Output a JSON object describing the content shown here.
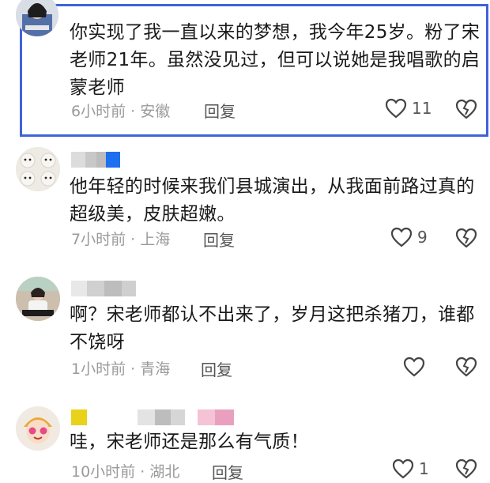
{
  "comments": [
    {
      "text": "你实现了我一直以来的梦想，我今年25岁。粉了宋老师21年。虽然没见过，但可以说她是我唱歌的启蒙老师",
      "time": "6小时前",
      "location": "安徽",
      "reply_label": "回复",
      "likes": "11",
      "highlighted": true,
      "avatar_icon": "user-avatar-photo"
    },
    {
      "text": "他年轻的时候来我们县城演出，从我面前路过真的超级美，皮肤超嫩。",
      "time": "7小时前",
      "location": "上海",
      "reply_label": "回复",
      "likes": "9",
      "avatar_icon": "puppies-avatar"
    },
    {
      "text": "啊？宋老师都认不出来了，岁月这把杀猪刀，谁都不饶呀",
      "time": "1小时前",
      "location": "青海",
      "reply_label": "回复",
      "likes": "",
      "avatar_icon": "girl-photo-avatar"
    },
    {
      "text": "哇，宋老师还是那么有气质！",
      "time": "10小时前",
      "location": "湖北",
      "reply_label": "回复",
      "likes": "1",
      "avatar_icon": "cartoon-face-avatar"
    }
  ],
  "colors": {
    "highlight_border": "#3f63d8",
    "meta_text": "#9a9a9a",
    "icon_stroke": "#444444"
  }
}
